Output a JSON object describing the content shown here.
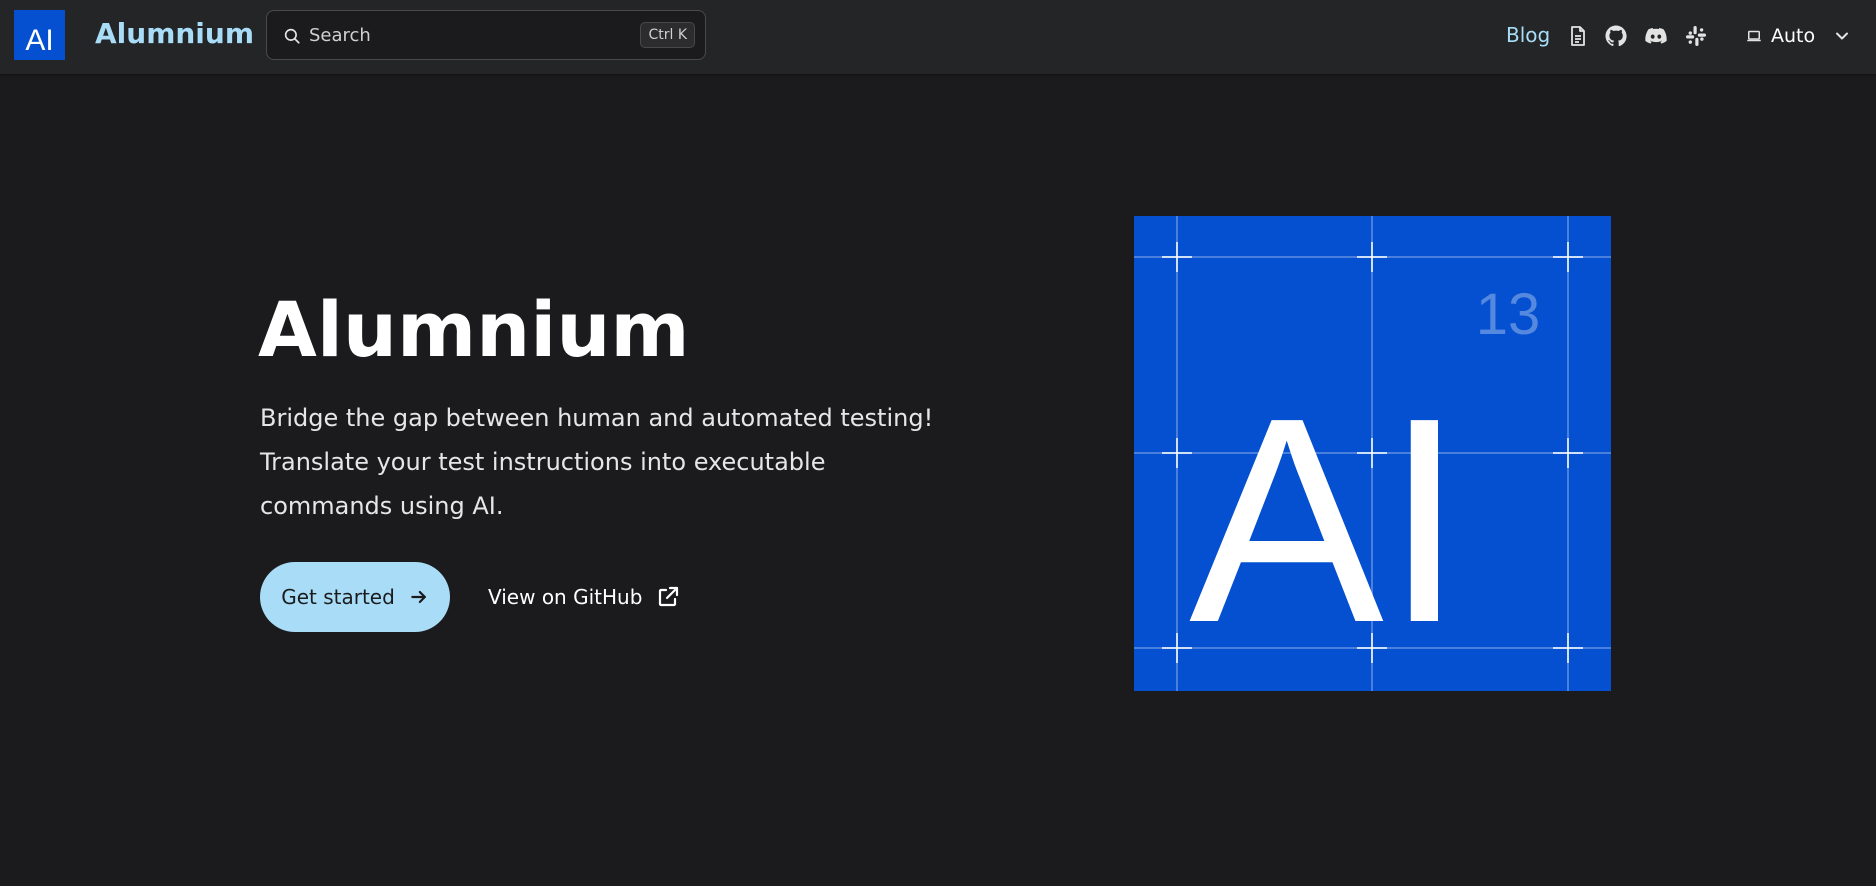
{
  "navbar": {
    "logo_text": "AI",
    "brand": "Alumnium",
    "search": {
      "placeholder": "Search",
      "shortcut": "Ctrl K"
    },
    "links": {
      "blog": "Blog",
      "docs_icon": "document-icon",
      "github_icon": "github-icon",
      "discord_icon": "discord-icon",
      "slack_icon": "slack-icon"
    },
    "theme": {
      "icon": "laptop-icon",
      "label": "Auto"
    }
  },
  "hero": {
    "title": "Alumnium",
    "subtitle": "Bridge the gap between human and automated testing! Translate your test instructions into executable commands using AI.",
    "primary_button": "Get started",
    "secondary_button": "View on GitHub"
  },
  "tile": {
    "symbol": "AI",
    "number": "13"
  },
  "colors": {
    "background": "#1b1b1d",
    "navbar": "#242526",
    "accent": "#a8dcf7",
    "tile_blue": "#0550d0"
  }
}
